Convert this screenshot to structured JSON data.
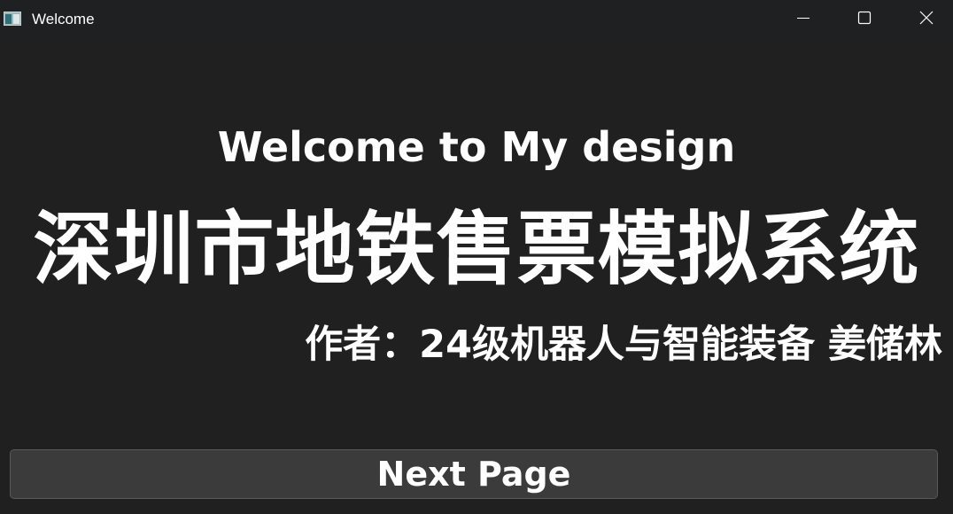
{
  "window": {
    "title": "Welcome",
    "icon": "app-window-icon",
    "controls": {
      "minimize": "minimize-icon",
      "maximize": "maximize-icon",
      "close": "close-icon"
    }
  },
  "content": {
    "welcome_text": "Welcome to My design",
    "main_title": "深圳市地铁售票模拟系统",
    "author_line": "作者：24级机器人与智能装备 姜储林"
  },
  "actions": {
    "next_label": "Next Page"
  },
  "colors": {
    "background": "#202020",
    "titlebar": "#1e2021",
    "text": "#ffffff",
    "button_bg": "#3b3b3b",
    "button_border": "#595959"
  }
}
